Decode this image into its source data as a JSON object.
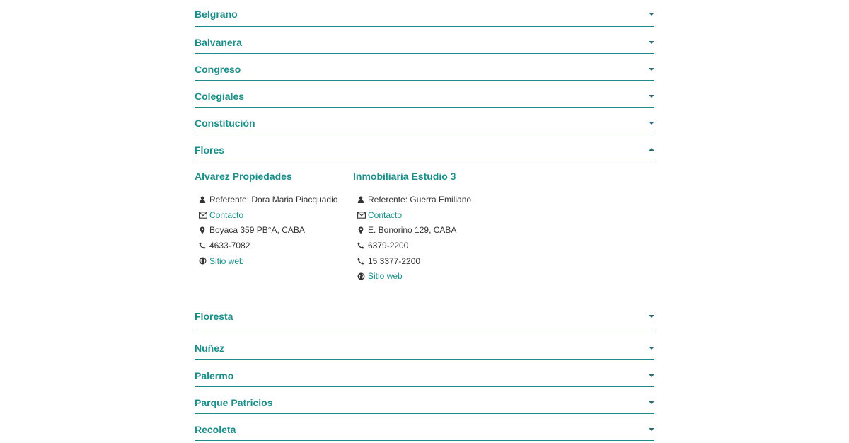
{
  "accordion_top": [
    {
      "label": "Belgrano"
    },
    {
      "label": "Balvanera"
    },
    {
      "label": "Congreso"
    },
    {
      "label": "Colegiales"
    },
    {
      "label": "Constitución"
    }
  ],
  "expanded": {
    "label": "Flores",
    "agencies": [
      {
        "name": "Alvarez Propiedades",
        "referente": "Referente: Dora Maria Piacquadio",
        "contacto": "Contacto",
        "address": "Boyaca 359 PB°A, CABA",
        "phones": [
          "4633-7082"
        ],
        "website": "Sitio web"
      },
      {
        "name": "Inmobiliaria Estudio 3",
        "referente": "Referente: Guerra Emiliano",
        "contacto": "Contacto",
        "address": "E. Bonorino 129, CABA",
        "phones": [
          "6379-2200",
          "15 3377-2200"
        ],
        "website": "Sitio web"
      }
    ]
  },
  "accordion_bottom": [
    {
      "label": "Floresta"
    },
    {
      "label": "Nuñez"
    },
    {
      "label": "Palermo"
    },
    {
      "label": "Parque Patricios"
    },
    {
      "label": "Recoleta"
    }
  ],
  "icons": {
    "collapsed": "caret-down-icon",
    "expanded": "caret-up-icon",
    "referente": "user-icon",
    "contacto": "envelope-icon",
    "address": "map-marker-icon",
    "phone": "phone-icon",
    "website": "globe-icon"
  },
  "colors": {
    "accent": "#1b8e8a",
    "caret": "#2d6d78",
    "text": "#333333"
  }
}
